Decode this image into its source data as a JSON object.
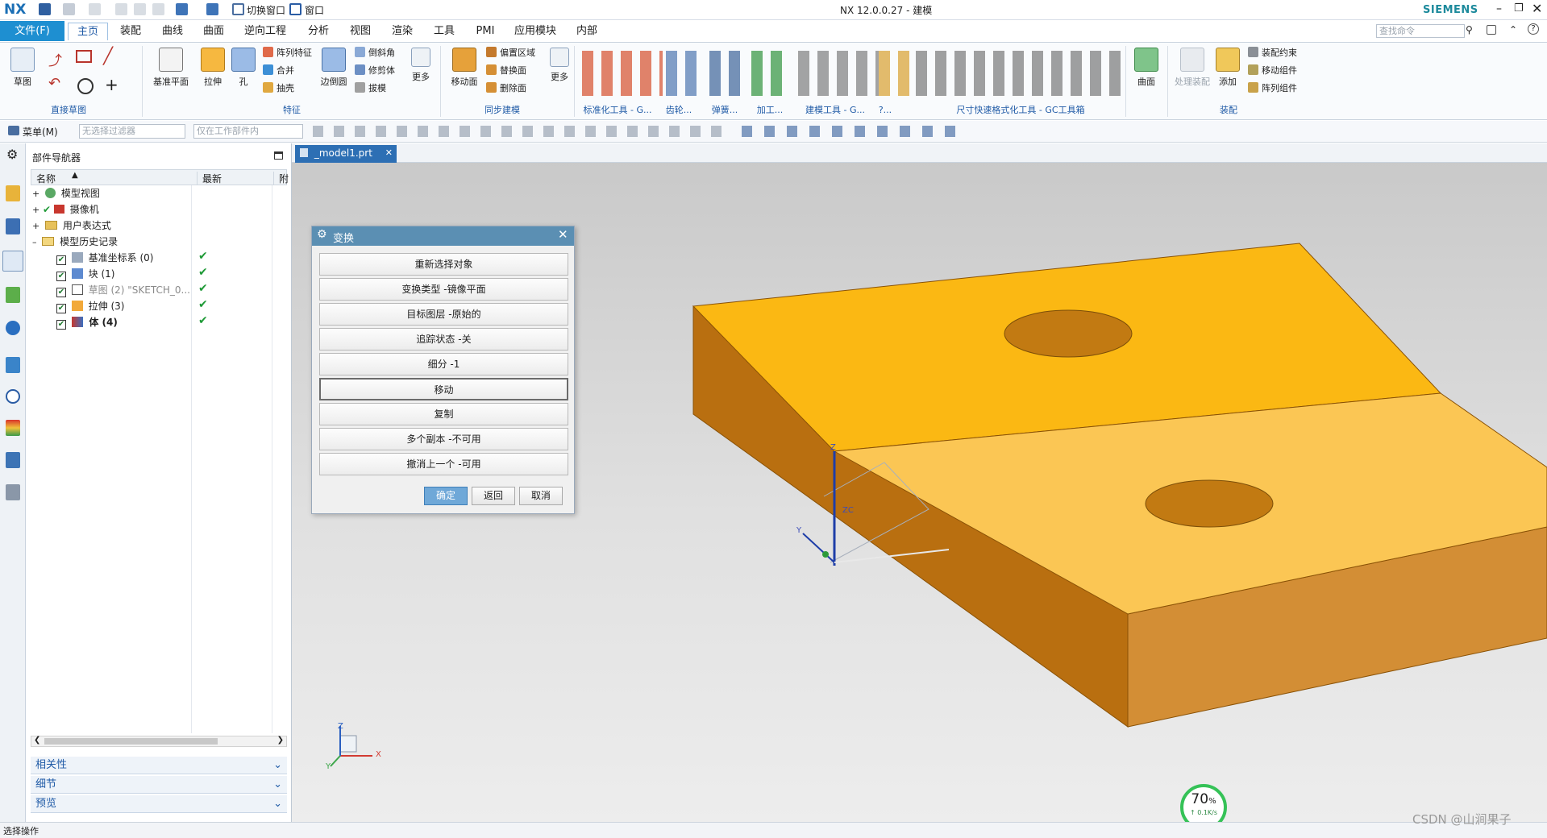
{
  "app": {
    "logo": "NX",
    "window_title": "NX 12.0.0.27 - 建模",
    "brand": "SIEMENS",
    "quick_access": {
      "switch_window": "切换窗口",
      "window": "窗口"
    },
    "search_placeholder": "查找命令"
  },
  "tabs": {
    "file": "文件(F)",
    "items": [
      "主页",
      "装配",
      "曲线",
      "曲面",
      "逆向工程",
      "分析",
      "视图",
      "渲染",
      "工具",
      "PMI",
      "应用模块",
      "内部"
    ],
    "active": "主页"
  },
  "ribbon": {
    "sketch": "草图",
    "group_direct_sketch": "直接草图",
    "datum_plane": "基准平面",
    "extrude": "拉伸",
    "hole": "孔",
    "pattern_feature": "阵列特征",
    "unite": "合并",
    "shell": "抽壳",
    "edge_blend": "边倒圆",
    "chamfer": "倒斜角",
    "trim_body": "修剪体",
    "draft": "拔模",
    "more": "更多",
    "group_feature": "特征",
    "move_face": "移动面",
    "offset_region": "偏置区域",
    "replace_face": "替换面",
    "delete_face": "删除面",
    "group_sync": "同步建模",
    "group_standard": "标准化工具 - G...",
    "group_gear": "齿轮...",
    "group_spring": "弹簧...",
    "group_machining": "加工...",
    "group_modeling_tools": "建模工具 - G...",
    "group_q": "?...",
    "group_dimension": "尺寸快速格式化工具 - GC工具箱",
    "surface": "曲面",
    "process_assembly": "处理装配",
    "add": "添加",
    "assembly_constraint": "装配约束",
    "move_component": "移动组件",
    "pattern_component": "阵列组件",
    "group_assembly": "装配"
  },
  "toolbar2": {
    "menu": "菜单(M)",
    "filter_placeholder": "无选择过滤器",
    "scope_placeholder": "仅在工作部件内"
  },
  "navigator": {
    "title": "部件导航器",
    "col_name": "名称",
    "col_latest": "最新",
    "col_extra": "附",
    "rows": [
      {
        "label": "模型视图"
      },
      {
        "label": "摄像机"
      },
      {
        "label": "用户表达式"
      },
      {
        "label": "模型历史记录"
      },
      {
        "label": "基准坐标系 (0)"
      },
      {
        "label": "块 (1)"
      },
      {
        "label": "草图 (2) \"SKETCH_0..."
      },
      {
        "label": "拉伸 (3)"
      },
      {
        "label": "体 (4)"
      }
    ],
    "panels": [
      "相关性",
      "细节",
      "预览"
    ]
  },
  "document_tab": "_model1.prt",
  "dialog": {
    "title": "变换",
    "buttons": [
      "重新选择对象",
      "变换类型 -镜像平面",
      "目标图层 -原始的",
      "追踪状态 -关",
      "细分 -1",
      "移动",
      "复制",
      "多个副本 -不可用",
      "撤消上一个 -可用"
    ],
    "ok": "确定",
    "back": "返回",
    "cancel": "取消"
  },
  "viewport": {
    "triad": {
      "x": "X",
      "y": "Y",
      "z": "Z"
    },
    "csys_labels": {
      "zc": "ZC",
      "z": "Z",
      "y": "Y"
    }
  },
  "network_widget": {
    "percent": "70",
    "unit": "%",
    "speed": "0.1K/s"
  },
  "status": "选择操作",
  "watermark": "CSDN @山涧果子",
  "colors": {
    "accent": "#1e8fd1",
    "dialog_header": "#5b8fb3",
    "part_top": "#fbb813",
    "part_side": "#d0892a",
    "check_green": "#1f9a37"
  }
}
